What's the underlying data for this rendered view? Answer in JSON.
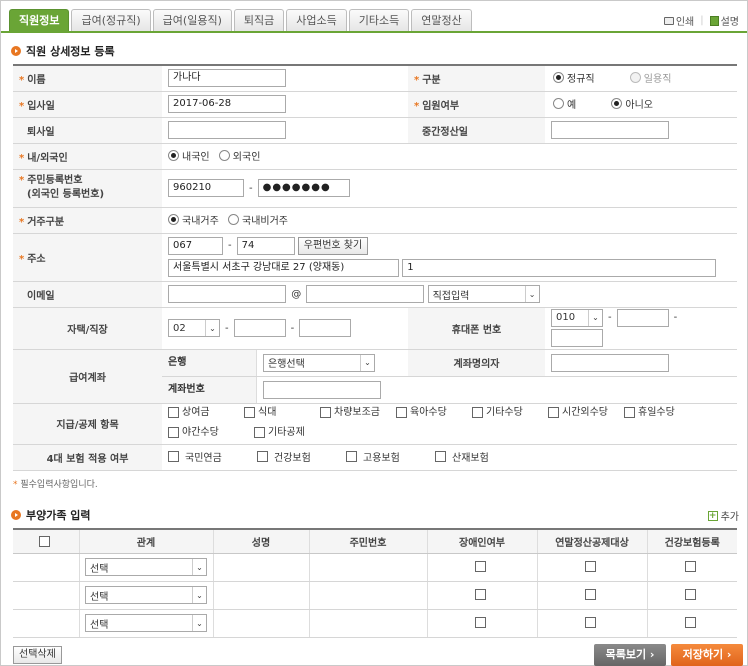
{
  "tabs": [
    "직원정보",
    "급여(정규직)",
    "급여(일용직)",
    "퇴직금",
    "사업소득",
    "기타소득",
    "연말정산"
  ],
  "toplinks": {
    "print": "인쇄",
    "help": "설명"
  },
  "section1_title": "직원 상세정보 등록",
  "fields": {
    "name_label": "이름",
    "name_value": "가나다",
    "type_label": "구분",
    "type_opt1": "정규직",
    "type_opt2": "일용직",
    "join_label": "입사일",
    "join_value": "2017-06-28",
    "exec_label": "임원여부",
    "exec_opt1": "예",
    "exec_opt2": "아니오",
    "leave_label": "퇴사일",
    "mid_label": "중간정산일",
    "nation_label": "내/외국인",
    "nation_opt1": "내국인",
    "nation_opt2": "외국인",
    "rrn_label1": "주민등록번호",
    "rrn_label2": "(외국인 등록번호)",
    "rrn_front": "960210",
    "rrn_back": "●●●●●●●",
    "res_label": "거주구분",
    "res_opt1": "국내거주",
    "res_opt2": "국내비거주",
    "addr_label": "주소",
    "zip1": "067",
    "zip2": "74",
    "zip_btn": "우편번호 찾기",
    "addr1": "서울특별시 서초구 강남대로 27 (양재동)",
    "addr2": "1",
    "email_label": "이메일",
    "email_at": "@",
    "email_select": "직접입력",
    "home_label": "자택/직장",
    "home_area": "02",
    "mobile_label": "휴대폰 번호",
    "mobile_area": "010",
    "salary_label": "급여계좌",
    "bank_label": "은행",
    "bank_select": "은행선택",
    "holder_label": "계좌명의자",
    "account_label": "계좌번호",
    "pay_label": "지급/공제 항목",
    "pay_items": [
      "상여금",
      "식대",
      "차량보조금",
      "육아수당",
      "기타수당",
      "시간외수당",
      "휴일수당",
      "야간수당",
      "기타공제"
    ],
    "ins_label": "4대 보험 적용 여부",
    "ins_items": [
      "국민연금",
      "건강보험",
      "고용보험",
      "산재보험"
    ]
  },
  "note": "필수입력사항입니다.",
  "note_star": "*",
  "req_mark": "*",
  "dash": "-",
  "section2_title": "부양가족 입력",
  "add_label": "추가",
  "add_icon": "+",
  "dep_headers": [
    "관계",
    "성명",
    "주민번호",
    "장애인여부",
    "연말정산공제대상",
    "건강보험등록"
  ],
  "dep_rows": [
    {
      "relation": "선택"
    },
    {
      "relation": "선택"
    },
    {
      "relation": "선택"
    }
  ],
  "buttons": {
    "delete": "선택삭제",
    "list": "목록보기 ›",
    "save": "저장하기 ›"
  },
  "colors": {
    "tab_active": "#6aa536",
    "required": "#e87722",
    "save": "#e0641c",
    "list": "#666666"
  }
}
